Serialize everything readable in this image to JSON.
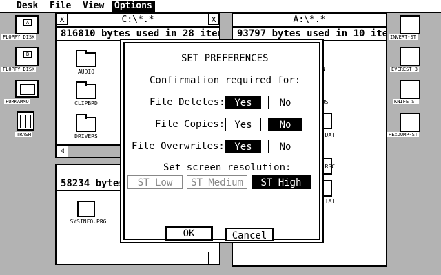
{
  "menubar": {
    "items": [
      "Desk",
      "File",
      "View",
      "Options"
    ],
    "active": "Options"
  },
  "desktop": {
    "left_icons": [
      "FLOPPY DISK",
      "FLOPPY DISK",
      "FURKAMMO",
      "TRASH"
    ],
    "right_icons": [
      "INVERT-ST",
      "EVEREST 3",
      "KNIFE ST",
      "HEXDUMP-ST"
    ]
  },
  "window1": {
    "title": "C:\\*.*",
    "close_glyph": "X",
    "full_glyph": "X",
    "info": "816810 bytes used in 28 item",
    "items": [
      "AUDIO",
      "CLIPBRD",
      "DRIVERS"
    ],
    "scroll_left": "◁"
  },
  "window2": {
    "title": "A:\\*.*",
    "info": "93797 bytes used in 10 ite",
    "fragments": [
      "GN",
      "ERS",
      "E.DAT",
      "E.RSC",
      "E.TXT"
    ]
  },
  "window3": {
    "info": "58234 bytes",
    "items": [
      "SYSINFO.PRG"
    ]
  },
  "dialog": {
    "title": "SET PREFERENCES",
    "subtitle": "Confirmation required for:",
    "rows": [
      {
        "label": "File Deletes:",
        "yes": "Yes",
        "no": "No",
        "selected": "yes"
      },
      {
        "label": "File Copies:",
        "yes": "Yes",
        "no": "No",
        "selected": "no"
      },
      {
        "label": "File Overwrites:",
        "yes": "Yes",
        "no": "No",
        "selected": "yes"
      }
    ],
    "resolution_label": "Set screen resolution:",
    "resolutions": [
      "ST Low",
      "ST Medium",
      "ST High"
    ],
    "resolution_selected": "ST High",
    "ok": "OK",
    "cancel": "Cancel"
  }
}
